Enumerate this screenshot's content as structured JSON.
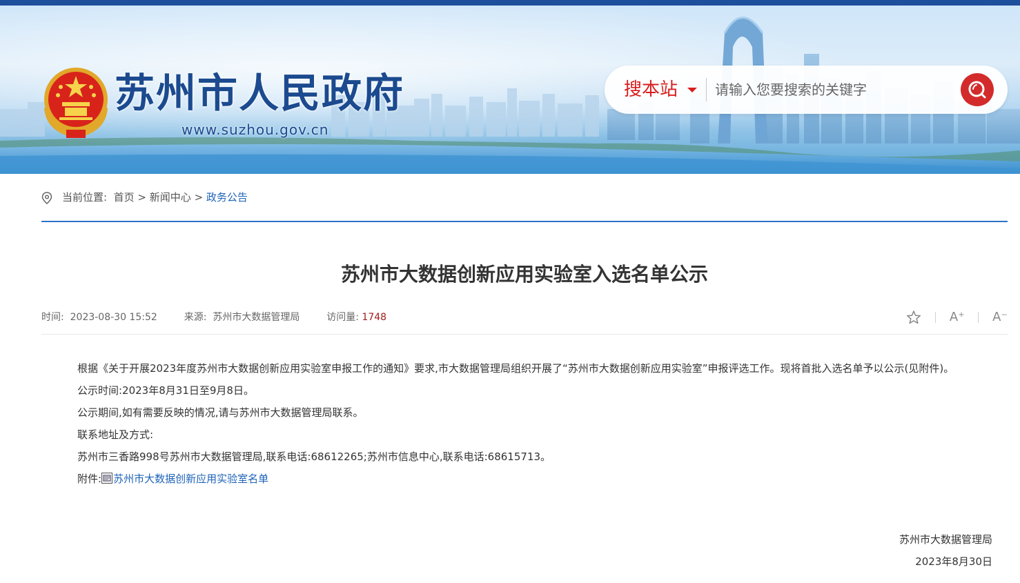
{
  "header": {
    "site_title": "苏州市人民政府",
    "site_url": "www.suzhou.gov.cn",
    "search_scope": "搜本站",
    "search_placeholder": "请输入您要搜索的关键字"
  },
  "breadcrumb": {
    "label": "当前位置:",
    "items": [
      "首页",
      "新闻中心",
      "政务公告"
    ],
    "separator": ">"
  },
  "article": {
    "title": "苏州市大数据创新应用实验室入选名单公示",
    "meta": {
      "time_label": "时间:",
      "time": "2023-08-30 15:52",
      "source_label": "来源:",
      "source": "苏州市大数据管理局",
      "views_label": "访问量:",
      "views": "1748"
    },
    "tools": {
      "font_increase": "A⁺",
      "font_decrease": "A⁻"
    },
    "paragraphs": [
      "根据《关于开展2023年度苏州市大数据创新应用实验室申报工作的通知》要求,市大数据管理局组织开展了“苏州市大数据创新应用实验室”申报评选工作。现将首批入选名单予以公示(见附件)。",
      "公示时间:2023年8月31日至9月8日。",
      "公示期间,如有需要反映的情况,请与苏州市大数据管理局联系。",
      "联系地址及方式:",
      "苏州市三香路998号苏州市大数据管理局,联系电话:68612265;苏州市信息中心,联系电话:68615713。"
    ],
    "attachment_label": "附件:",
    "attachment_link": "苏州市大数据创新应用实验室名单",
    "signature_org": "苏州市大数据管理局",
    "signature_date": "2023年8月30日"
  },
  "colors": {
    "brand_blue": "#1b4a8f",
    "accent_red": "#d32b2b",
    "link_blue": "#1e63b8"
  },
  "icons": [
    "national-emblem-icon",
    "search-icon",
    "location-pin-icon",
    "star-icon",
    "attachment-icon",
    "dropdown-caret-icon"
  ]
}
